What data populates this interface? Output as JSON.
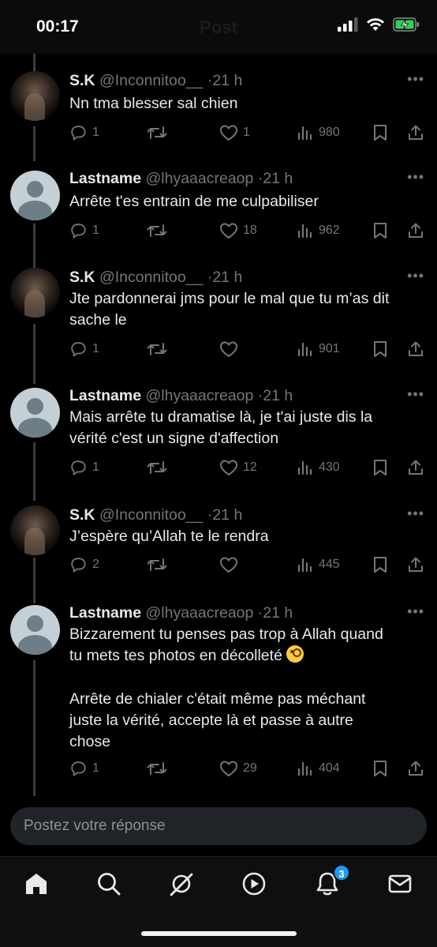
{
  "status_bar": {
    "time": "00:17",
    "header_title": "Post",
    "battery_state": "charging"
  },
  "tweets": [
    {
      "name": "S.K",
      "handle": "@Inconnitoo__",
      "age": "21 h",
      "avatar": "photo",
      "text": "Nn tma blesser sal chien",
      "replies": "1",
      "retweets": "",
      "likes": "1",
      "views": "980"
    },
    {
      "name": "Lastname",
      "handle": "@lhyaaacreaop",
      "age": "21 h",
      "avatar": "default",
      "text": "Arrête t'es entrain de me culpabiliser",
      "replies": "1",
      "retweets": "",
      "likes": "18",
      "views": "962"
    },
    {
      "name": "S.K",
      "handle": "@Inconnitoo__",
      "age": "21 h",
      "avatar": "photo",
      "text": "Jte pardonnerai jms pour le mal que tu m’as dit\nsache le",
      "replies": "1",
      "retweets": "",
      "likes": "",
      "views": "901"
    },
    {
      "name": "Lastname",
      "handle": "@lhyaaacreaop",
      "age": "21 h",
      "avatar": "default",
      "text": "Mais arrête tu dramatise là, je t'ai juste dis la\nvérité c'est un signe d'affection",
      "replies": "1",
      "retweets": "",
      "likes": "12",
      "views": "430"
    },
    {
      "name": "S.K",
      "handle": "@Inconnitoo__",
      "age": "21 h",
      "avatar": "photo",
      "text": "J’espère qu’Allah te le rendra",
      "replies": "2",
      "retweets": "",
      "likes": "",
      "views": "445"
    },
    {
      "name": "Lastname",
      "handle": "@lhyaaacreaop",
      "age": "21 h",
      "avatar": "default",
      "text": "Bizzarement tu penses pas trop à Allah quand\ntu mets tes photos en décolleté ",
      "text_emoji": "face-with-monocle",
      "text2": "Arrête de chialer c'était même pas méchant\njuste la vérité, accepte là et passe à autre\nchose",
      "replies": "1",
      "retweets": "",
      "likes": "29",
      "views": "404"
    }
  ],
  "reply_bar": {
    "placeholder": "Postez votre réponse"
  },
  "tab_bar": {
    "items": [
      "home-icon",
      "search-icon",
      "grok-icon",
      "video-icon",
      "notifications-icon",
      "messages-icon"
    ],
    "notification_count": "3"
  },
  "colors": {
    "background": "#000000",
    "text": "#e7e9ea",
    "muted": "#71767b",
    "accent": "#1d9bf0"
  }
}
